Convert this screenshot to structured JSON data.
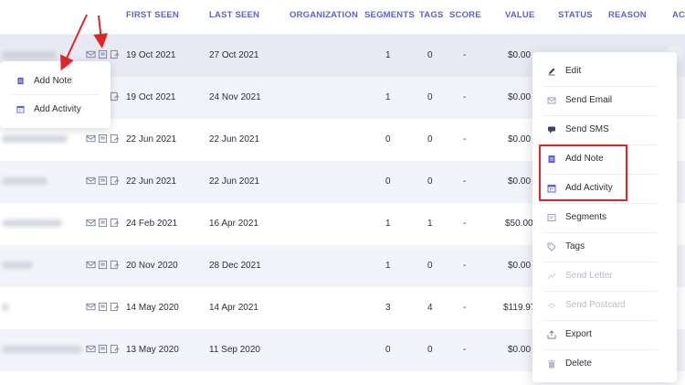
{
  "header": {
    "first_seen": "FIRST SEEN",
    "last_seen": "LAST SEEN",
    "organization": "ORGANIZATION",
    "segments": "SEGMENTS",
    "tags": "TAGS",
    "score": "SCORE",
    "value": "VALUE",
    "status": "STATUS",
    "reason": "REASON",
    "actions": "AC"
  },
  "rows": [
    {
      "first_seen": "19 Oct 2021",
      "last_seen": "27 Oct 2021",
      "segments": "1",
      "tags": "0",
      "score": "-",
      "value": "$0.00"
    },
    {
      "first_seen": "19 Oct 2021",
      "last_seen": "24 Nov 2021",
      "segments": "1",
      "tags": "0",
      "score": "-",
      "value": "$0.00"
    },
    {
      "first_seen": "22 Jun 2021",
      "last_seen": "22 Jun 2021",
      "segments": "0",
      "tags": "0",
      "score": "-",
      "value": "$0.00"
    },
    {
      "first_seen": "22 Jun 2021",
      "last_seen": "22 Jun 2021",
      "segments": "0",
      "tags": "0",
      "score": "-",
      "value": "$0.00"
    },
    {
      "first_seen": "24 Feb 2021",
      "last_seen": "16 Apr 2021",
      "segments": "1",
      "tags": "1",
      "score": "-",
      "value": "$50.00"
    },
    {
      "first_seen": "20 Nov 2020",
      "last_seen": "28 Dec 2021",
      "segments": "1",
      "tags": "0",
      "score": "-",
      "value": "$0.00"
    },
    {
      "first_seen": "14 May 2020",
      "last_seen": "14 Apr 2021",
      "segments": "3",
      "tags": "4",
      "score": "-",
      "value": "$119.97"
    },
    {
      "first_seen": "13 May 2020",
      "last_seen": "11 Sep 2020",
      "segments": "0",
      "tags": "0",
      "score": "-",
      "value": "$0.00"
    }
  ],
  "row_icons": [
    "mail-icon",
    "note-icon",
    "activity-icon"
  ],
  "left_menu": {
    "add_note": "Add Note",
    "add_activity": "Add Activity"
  },
  "context_menu": {
    "edit": "Edit",
    "send_email": "Send Email",
    "send_sms": "Send SMS",
    "add_note": "Add Note",
    "add_activity": "Add Activity",
    "segments": "Segments",
    "tags": "Tags",
    "send_letter": "Send Letter",
    "send_postcard": "Send Postcard",
    "export": "Export",
    "delete": "Delete"
  },
  "colors": {
    "header_text": "#5c62d6",
    "highlight_box": "#e0252a",
    "arrow": "#e0252a",
    "disabled_text": "#b8bbc8"
  }
}
